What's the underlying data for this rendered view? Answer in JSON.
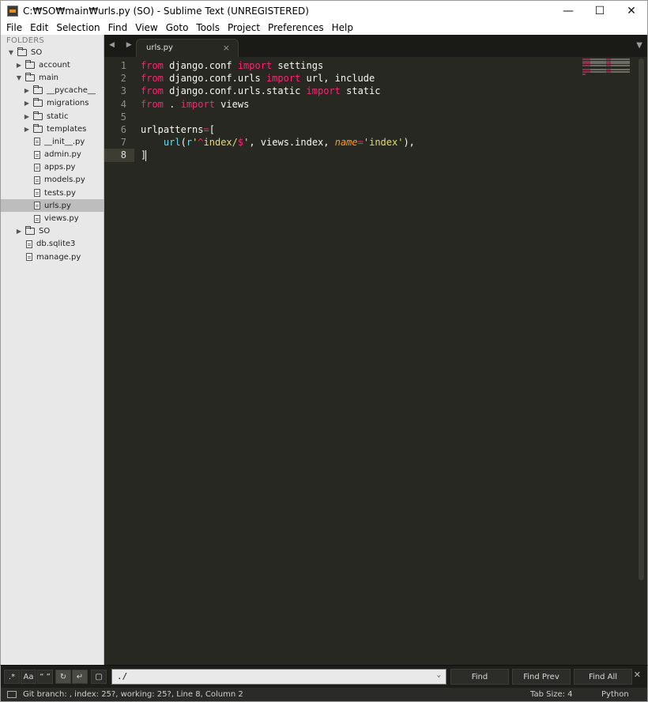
{
  "window": {
    "title": "C:₩SO₩main₩urls.py (SO) - Sublime Text (UNREGISTERED)",
    "minimize": "—",
    "maximize": "☐",
    "close": "✕"
  },
  "menu": [
    "File",
    "Edit",
    "Selection",
    "Find",
    "View",
    "Goto",
    "Tools",
    "Project",
    "Preferences",
    "Help"
  ],
  "sidebar": {
    "header": "FOLDERS",
    "items": [
      {
        "label": "SO",
        "type": "folder",
        "depth": 0,
        "expanded": true
      },
      {
        "label": "account",
        "type": "folder",
        "depth": 1,
        "expanded": false
      },
      {
        "label": "main",
        "type": "folder",
        "depth": 1,
        "expanded": true
      },
      {
        "label": "__pycache__",
        "type": "folder",
        "depth": 2,
        "expanded": false
      },
      {
        "label": "migrations",
        "type": "folder",
        "depth": 2,
        "expanded": false
      },
      {
        "label": "static",
        "type": "folder",
        "depth": 2,
        "expanded": false
      },
      {
        "label": "templates",
        "type": "folder",
        "depth": 2,
        "expanded": false
      },
      {
        "label": "__init__.py",
        "type": "file",
        "depth": 2
      },
      {
        "label": "admin.py",
        "type": "file",
        "depth": 2
      },
      {
        "label": "apps.py",
        "type": "file",
        "depth": 2
      },
      {
        "label": "models.py",
        "type": "file",
        "depth": 2
      },
      {
        "label": "tests.py",
        "type": "file",
        "depth": 2
      },
      {
        "label": "urls.py",
        "type": "file",
        "depth": 2,
        "selected": true
      },
      {
        "label": "views.py",
        "type": "file",
        "depth": 2
      },
      {
        "label": "SO",
        "type": "folder",
        "depth": 1,
        "expanded": false
      },
      {
        "label": "db.sqlite3",
        "type": "file",
        "depth": 1
      },
      {
        "label": "manage.py",
        "type": "file",
        "depth": 1
      }
    ]
  },
  "tabs": {
    "nav": "◀ ▶",
    "active": {
      "label": "urls.py",
      "close": "×"
    },
    "dropdown": "▼"
  },
  "editor": {
    "line_numbers": [
      "1",
      "2",
      "3",
      "4",
      "5",
      "6",
      "7",
      "8"
    ],
    "current_line": 8,
    "lines": [
      [
        {
          "t": "from",
          "c": "kw"
        },
        {
          "t": " django.conf ",
          "c": ""
        },
        {
          "t": "import",
          "c": "kw"
        },
        {
          "t": " settings",
          "c": ""
        }
      ],
      [
        {
          "t": "from",
          "c": "kw"
        },
        {
          "t": " django.conf.urls ",
          "c": ""
        },
        {
          "t": "import",
          "c": "kw"
        },
        {
          "t": " url, include",
          "c": ""
        }
      ],
      [
        {
          "t": "from",
          "c": "kw"
        },
        {
          "t": " django.conf.urls.static ",
          "c": ""
        },
        {
          "t": "import",
          "c": "kw"
        },
        {
          "t": " static",
          "c": ""
        }
      ],
      [
        {
          "t": "from",
          "c": "kw"
        },
        {
          "t": " . ",
          "c": ""
        },
        {
          "t": "import",
          "c": "kw"
        },
        {
          "t": " views",
          "c": ""
        }
      ],
      [],
      [
        {
          "t": "urlpatterns",
          "c": ""
        },
        {
          "t": "=",
          "c": "kw"
        },
        {
          "t": "[",
          "c": ""
        }
      ],
      [
        {
          "t": "    ",
          "c": ""
        },
        {
          "t": "url",
          "c": "fn"
        },
        {
          "t": "(",
          "c": ""
        },
        {
          "t": "r",
          "c": "fn"
        },
        {
          "t": "'",
          "c": "str"
        },
        {
          "t": "^",
          "c": "kw"
        },
        {
          "t": "index/",
          "c": "str"
        },
        {
          "t": "$",
          "c": "kw"
        },
        {
          "t": "'",
          "c": "str"
        },
        {
          "t": ", views.index, ",
          "c": ""
        },
        {
          "t": "name",
          "c": "arg"
        },
        {
          "t": "=",
          "c": "kw"
        },
        {
          "t": "'index'",
          "c": "str"
        },
        {
          "t": "),",
          "c": ""
        }
      ],
      [
        {
          "t": "]",
          "c": ""
        }
      ]
    ]
  },
  "find_panel": {
    "options": [
      ".*",
      "Aa",
      "“ ”",
      "↻",
      "↵",
      "▢"
    ],
    "options_on": [
      false,
      false,
      false,
      true,
      true,
      false
    ],
    "query": "./",
    "dropdown": "⌄",
    "find_label": "Find",
    "find_prev_label": "Find Prev",
    "find_all_label": "Find All",
    "close": "✕"
  },
  "status": {
    "text": "Git branch: , index: 25?, working: 25?, Line 8, Column 2",
    "tab_size": "Tab Size: 4",
    "syntax": "Python"
  },
  "colors": {
    "editor_bg": "#272822",
    "keyword": "#f92672",
    "string": "#e6db74",
    "function": "#66d9ef",
    "argument": "#fd971f"
  }
}
